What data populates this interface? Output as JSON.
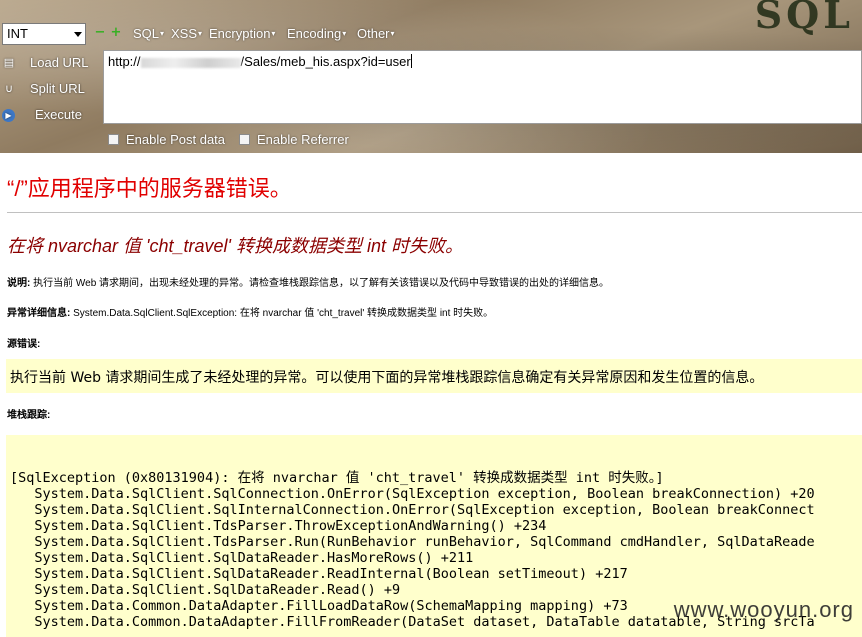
{
  "hackbar": {
    "logo": "SQL",
    "select_value": "INT",
    "zoom_out": "−",
    "zoom_in": "+",
    "menus": [
      "SQL",
      "XSS",
      "Encryption",
      "Encoding",
      "Other"
    ],
    "load_url": "Load URL",
    "split_url": "Split URL",
    "execute": "Execute",
    "url_prefix": "http://",
    "url_suffix": "/Sales/meb_his.aspx?id=user",
    "enable_post": "Enable Post data",
    "enable_referrer": "Enable Referrer"
  },
  "page": {
    "title": "“/”应用程序中的服务器错误。",
    "subtitle": "在将 nvarchar 值 'cht_travel' 转换成数据类型 int 时失败。",
    "desc_label": "说明:",
    "desc_text": " 执行当前 Web 请求期间，出现未经处理的异常。请检查堆栈跟踪信息，以了解有关该错误以及代码中导致错误的出处的详细信息。",
    "ex_label": "异常详细信息:",
    "ex_text": " System.Data.SqlClient.SqlException: 在将 nvarchar 值 'cht_travel' 转换成数据类型 int 时失败。",
    "src_label": "源错误:",
    "src_text": "执行当前 Web 请求期间生成了未经处理的异常。可以使用下面的异常堆栈跟踪信息确定有关异常原因和发生位置的信息。",
    "stack_label": "堆栈跟踪:",
    "stack_lines": [
      "[SqlException (0x80131904): 在将 nvarchar 值 'cht_travel' 转换成数据类型 int 时失败。]",
      "   System.Data.SqlClient.SqlConnection.OnError(SqlException exception, Boolean breakConnection) +20",
      "   System.Data.SqlClient.SqlInternalConnection.OnError(SqlException exception, Boolean breakConnect",
      "   System.Data.SqlClient.TdsParser.ThrowExceptionAndWarning() +234",
      "   System.Data.SqlClient.TdsParser.Run(RunBehavior runBehavior, SqlCommand cmdHandler, SqlDataReade",
      "   System.Data.SqlClient.SqlDataReader.HasMoreRows() +211",
      "   System.Data.SqlClient.SqlDataReader.ReadInternal(Boolean setTimeout) +217",
      "   System.Data.SqlClient.SqlDataReader.Read() +9",
      "   System.Data.Common.DataAdapter.FillLoadDataRow(SchemaMapping mapping) +73",
      "   System.Data.Common.DataAdapter.FillFromReader(DataSet dataset, DataTable datatable, String srcTa"
    ],
    "watermark": "www.wooyun.org"
  }
}
